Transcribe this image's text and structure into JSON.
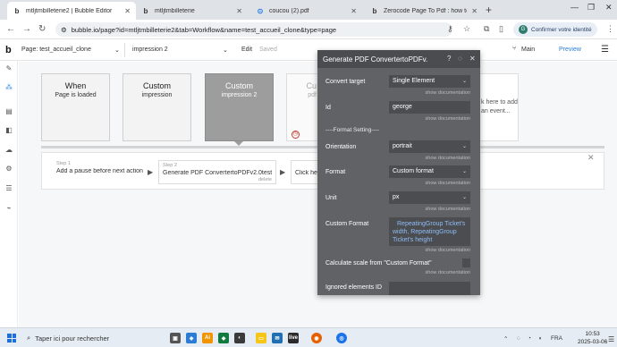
{
  "browser": {
    "tabs": [
      {
        "title": "mtljtmbilleterie2 | Bubble Editor",
        "icon": "bubble-favicon",
        "active": true
      },
      {
        "title": "mtljtmbilleterie",
        "icon": "bubble-favicon",
        "active": false
      },
      {
        "title": "coucou (2).pdf",
        "icon": "pdf-favicon",
        "active": false
      },
      {
        "title": "Zerocode Page To Pdf : how to",
        "icon": "bubble-favicon",
        "active": false
      }
    ],
    "url": "bubble.io/page?id=mtljtmbilleterie2&tab=Workflow&name=test_accueil_clone&type=page",
    "profile_label": "Confirmer votre identité"
  },
  "appbar": {
    "logo": "b",
    "page_label": "Page: test_accueil_clone",
    "workflow_label": "impression 2",
    "edit_label": "Edit",
    "saved_label": "Saved",
    "branch_label": "Main",
    "preview_label": "Preview"
  },
  "events": [
    {
      "title": "When",
      "subtitle": "Page is loaded"
    },
    {
      "title": "Custom",
      "subtitle": "impression"
    },
    {
      "title": "Custom",
      "subtitle": "impression 2"
    },
    {
      "title": "Cu",
      "subtitle": "pdf"
    },
    {
      "title": "",
      "subtitle": "k here to add an event..."
    }
  ],
  "workflow_steps": [
    {
      "label": "Step 1",
      "title": "Add a pause before next action"
    },
    {
      "label": "Step 2",
      "title": "Generate PDF ConvertertoPDFv2.0test A",
      "delete_label": "delete"
    },
    {
      "label": "",
      "title": "Click he"
    }
  ],
  "panel": {
    "title": "Generate PDF ConvertertoPDFv.",
    "doc_label": "show documentation",
    "rows": {
      "convert_target": {
        "label": "Convert target",
        "value": "Single Element"
      },
      "id": {
        "label": "Id",
        "value": "george"
      },
      "format_section": "----Format Setting----",
      "orientation": {
        "label": "Orientation",
        "value": "portrait"
      },
      "format": {
        "label": "Format",
        "value": "Custom format"
      },
      "unit": {
        "label": "Unit",
        "value": "px"
      },
      "custom_format": {
        "label": "Custom Format",
        "value_line1": "RepeatingGroup Ticket's",
        "value_line2": "width, RepeatingGroup",
        "value_line3": "Ticket's height"
      },
      "calc_scale": {
        "label": "Calculate scale from \"Custom Format\""
      },
      "ignored": {
        "label": "Ignored elements ID",
        "value": ""
      }
    }
  },
  "taskbar": {
    "search_placeholder": "Taper ici pour rechercher",
    "language": "FRA",
    "time": "10:53",
    "date": "2025-03-06"
  }
}
